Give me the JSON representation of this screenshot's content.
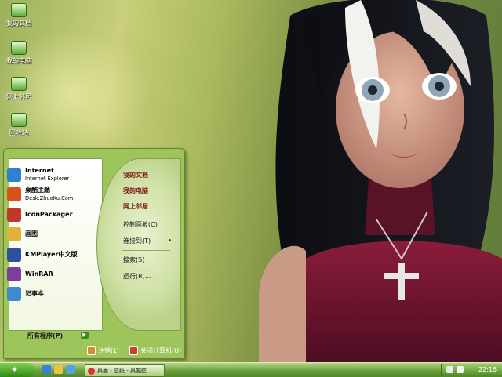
{
  "desktop_icons": [
    {
      "label": "我的文档",
      "icon": "my-documents-icon"
    },
    {
      "label": "我的电脑",
      "icon": "my-computer-icon"
    },
    {
      "label": "网上邻居",
      "icon": "network-places-icon"
    },
    {
      "label": "回收站",
      "icon": "recycle-bin-icon"
    }
  ],
  "start_menu": {
    "programs": [
      {
        "title": "Internet",
        "subtitle": "Internet Explorer",
        "icon": "ie-icon",
        "color": "#2f7fd4"
      },
      {
        "title": "桌酷主题",
        "subtitle": "Desk.ZhuoKu.Com",
        "icon": "zhuoku-icon",
        "color": "#d9501d"
      },
      {
        "title": "IconPackager",
        "subtitle": "",
        "icon": "iconpackager-icon",
        "color": "#c3362a"
      },
      {
        "title": "画图",
        "subtitle": "",
        "icon": "paint-icon",
        "color": "#e0b23a"
      },
      {
        "title": "KMPlayer中文版",
        "subtitle": "",
        "icon": "kmplayer-icon",
        "color": "#2e4f9e"
      },
      {
        "title": "WinRAR",
        "subtitle": "",
        "icon": "winrar-icon",
        "color": "#7a3e9e"
      },
      {
        "title": "记事本",
        "subtitle": "",
        "icon": "notepad-icon",
        "color": "#3c8bd0"
      }
    ],
    "all_programs": "所有程序(P)",
    "places": [
      {
        "label": "我的文档"
      },
      {
        "label": "我的电脑"
      },
      {
        "label": "网上邻居"
      },
      {
        "label": "控制面板(C)"
      },
      {
        "label": "连接到(T)",
        "arrow": "▸"
      },
      {
        "label": "搜索(S)"
      },
      {
        "label": "运行(R)..."
      }
    ],
    "logoff": "注销(L)",
    "shutdown": "关闭计算机(U)"
  },
  "taskbar": {
    "window_title": "桌面 - 壁纸 - 桌酷壁...",
    "clock": "22:16"
  }
}
